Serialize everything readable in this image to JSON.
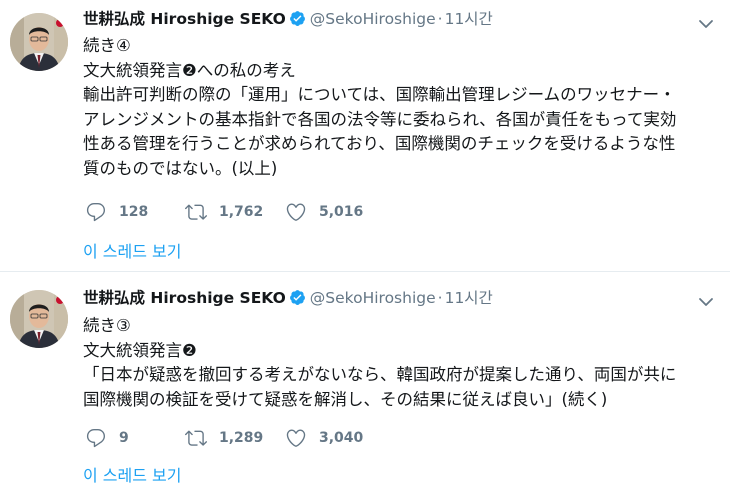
{
  "tweets": [
    {
      "author_name": "世耕弘成 Hiroshige SEKO",
      "handle": "@SekoHiroshige",
      "separator": "·",
      "time": "11시간",
      "lines": [
        "続き④",
        "文大統領発言❷への私の考え",
        "輸出許可判断の際の「運用」については、国際輸出管理レジームのワッセナー・",
        "アレンジメントの基本指針で各国の法令等に委ねられ、各国が責任をもって実効",
        "性ある管理を行うことが求められており、国際機関のチェックを受けるような性",
        "質のものではない。(以上)"
      ],
      "replies": "128",
      "retweets": "1,762",
      "likes": "5,016",
      "thread_label": "이 스레드 보기"
    },
    {
      "author_name": "世耕弘成 Hiroshige SEKO",
      "handle": "@SekoHiroshige",
      "separator": "·",
      "time": "11시간",
      "lines": [
        "続き③",
        "文大統領発言❷",
        "「日本が疑惑を撤回する考えがないなら、韓国政府が提案した通り、両国が共に",
        "国際機関の検証を受けて疑惑を解消し、その結果に従えば良い」(続く)"
      ],
      "replies": "9",
      "retweets": "1,289",
      "likes": "3,040",
      "thread_label": "이 스레드 보기"
    }
  ],
  "colors": {
    "accent": "#1da1f2",
    "muted": "#657786",
    "text": "#14171a",
    "verified": "#1da1f2"
  },
  "icons": [
    "reply-icon",
    "retweet-icon",
    "like-icon",
    "verified-badge-icon",
    "caret-down-icon"
  ]
}
